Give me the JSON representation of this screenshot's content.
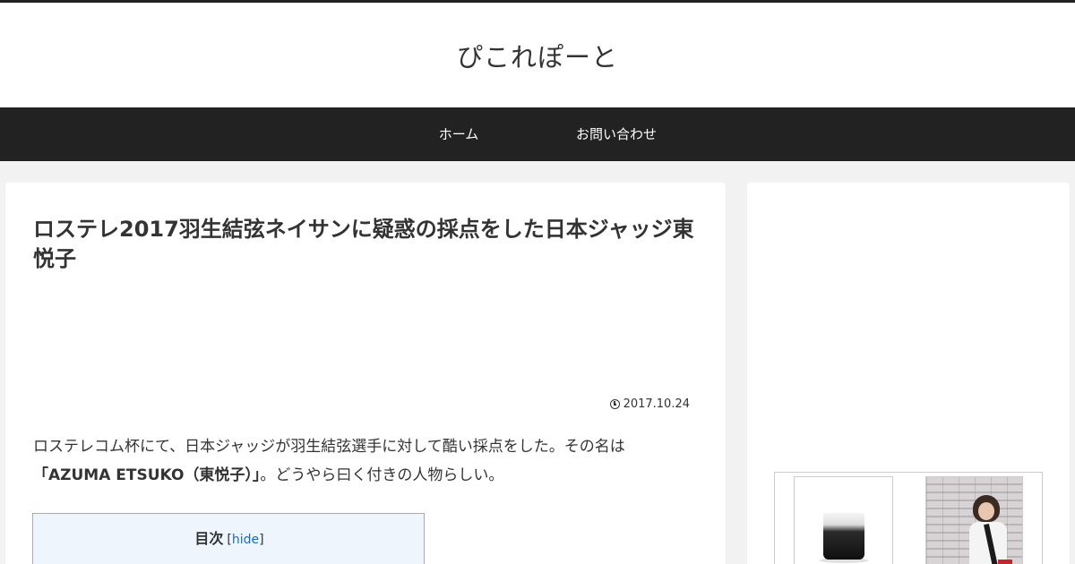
{
  "site": {
    "title": "ぴこれぽーと"
  },
  "nav": {
    "items": [
      {
        "label": "ホーム"
      },
      {
        "label": "お問い合わせ"
      }
    ]
  },
  "article": {
    "title": "ロステレ2017羽生結弦ネイサンに疑惑の採点をした日本ジャッジ東悦子",
    "date": "2017.10.24",
    "intro_1": "ロステレコム杯にて、日本ジャッジが羽生結弦選手に対して酷い採点をした。その名は",
    "intro_bold": "「AZUMA ETSUKO（東悦子）」",
    "intro_2": "。どうやら曰く付きの人物らしい。"
  },
  "toc": {
    "title": "目次",
    "bracket_open": "[",
    "toggle_label": "hide",
    "bracket_close": "]"
  },
  "colors": {
    "header_bg": "#ffffff",
    "nav_bg": "#222222",
    "page_bg": "#f2f2f2",
    "toc_bg": "#eef5fd",
    "link": "#1e6bb8"
  },
  "icons": {
    "date": "clock-icon"
  }
}
